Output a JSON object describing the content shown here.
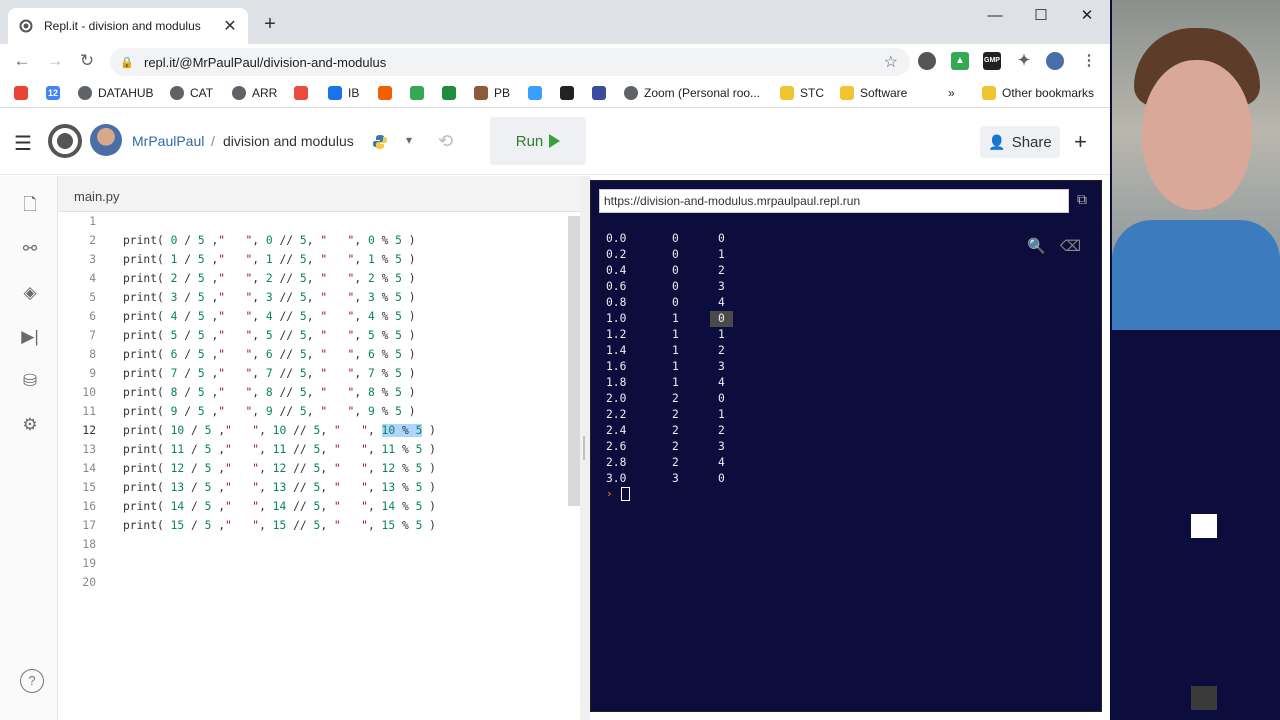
{
  "browser": {
    "tab_title": "Repl.it - division and modulus",
    "url": "repl.it/@MrPaulPaul/division-and-modulus",
    "bookmarks": [
      {
        "label": "",
        "icon": "gmail-icon",
        "color": "#ea4335"
      },
      {
        "label": "",
        "icon": "calendar-icon",
        "color": "#4285f4",
        "text": "12"
      },
      {
        "label": "DATAHUB",
        "icon": "globe-icon",
        "color": "#5f6368"
      },
      {
        "label": "CAT",
        "icon": "globe-icon",
        "color": "#5f6368"
      },
      {
        "label": "ARR",
        "icon": "globe-icon",
        "color": "#5f6368"
      },
      {
        "label": "",
        "icon": "extension-icon",
        "color": "#e94e3c"
      },
      {
        "label": "IB",
        "icon": "ib-icon",
        "color": "#1a73e8"
      },
      {
        "label": "",
        "icon": "red-square-icon",
        "color": "#f06000"
      },
      {
        "label": "",
        "icon": "drive-icon",
        "color": "#34a853"
      },
      {
        "label": "",
        "icon": "classroom-icon",
        "color": "#1e8e3e"
      },
      {
        "label": "PB",
        "icon": "profile-icon",
        "color": "#8d5a3c"
      },
      {
        "label": "",
        "icon": "bolt-icon",
        "color": "#3aa0ff"
      },
      {
        "label": "",
        "icon": "github-icon",
        "color": "#222222"
      },
      {
        "label": "",
        "icon": "calendar-square-icon",
        "color": "#3c4b9e"
      },
      {
        "label": "Zoom (Personal roo...",
        "icon": "globe-icon",
        "color": "#5f6368"
      },
      {
        "label": "STC",
        "icon": "folder-icon",
        "color": "#f4c430"
      },
      {
        "label": "Software",
        "icon": "folder-icon",
        "color": "#f4c430"
      }
    ],
    "more_bookmarks": "»",
    "other_bookmarks": "Other bookmarks"
  },
  "replit": {
    "username": "MrPaulPaul",
    "separator": "/",
    "project_name": "division and modulus",
    "run_label": "Run",
    "share_label": "Share",
    "file_tab": "main.py"
  },
  "editor": {
    "lines": [
      {
        "n": "1",
        "text": ""
      },
      {
        "n": "2",
        "text": "print( 0 / 5 ,\"   \", 0 // 5, \"   \", 0 % 5 )"
      },
      {
        "n": "3",
        "text": "print( 1 / 5 ,\"   \", 1 // 5, \"   \", 1 % 5 )"
      },
      {
        "n": "4",
        "text": "print( 2 / 5 ,\"   \", 2 // 5, \"   \", 2 % 5 )"
      },
      {
        "n": "5",
        "text": "print( 3 / 5 ,\"   \", 3 // 5, \"   \", 3 % 5 )"
      },
      {
        "n": "6",
        "text": "print( 4 / 5 ,\"   \", 4 // 5, \"   \", 4 % 5 )"
      },
      {
        "n": "7",
        "text": "print( 5 / 5 ,\"   \", 5 // 5, \"   \", 5 % 5 )"
      },
      {
        "n": "8",
        "text": "print( 6 / 5 ,\"   \", 6 // 5, \"   \", 6 % 5 )"
      },
      {
        "n": "9",
        "text": "print( 7 / 5 ,\"   \", 7 // 5, \"   \", 7 % 5 )"
      },
      {
        "n": "10",
        "text": "print( 8 / 5 ,\"   \", 8 // 5, \"   \", 8 % 5 )"
      },
      {
        "n": "11",
        "text": "print( 9 / 5 ,\"   \", 9 // 5, \"   \", 9 % 5 )"
      },
      {
        "n": "12",
        "text": "print( 10 / 5 ,\"   \", 10 // 5, \"   \", 10 % 5 )",
        "active": true
      },
      {
        "n": "13",
        "text": "print( 11 / 5 ,\"   \", 11 // 5, \"   \", 11 % 5 )"
      },
      {
        "n": "14",
        "text": "print( 12 / 5 ,\"   \", 12 // 5, \"   \", 12 % 5 )"
      },
      {
        "n": "15",
        "text": "print( 13 / 5 ,\"   \", 13 // 5, \"   \", 13 % 5 )"
      },
      {
        "n": "16",
        "text": "print( 14 / 5 ,\"   \", 14 // 5, \"   \", 14 % 5 )"
      },
      {
        "n": "17",
        "text": "print( 15 / 5 ,\"   \", 15 // 5, \"   \", 15 % 5 )"
      },
      {
        "n": "18",
        "text": ""
      },
      {
        "n": "19",
        "text": ""
      },
      {
        "n": "20",
        "text": ""
      }
    ],
    "selected_text": "10 % 5"
  },
  "console": {
    "url": "https://division-and-modulus.mrpaulpaul.repl.run",
    "rows": [
      [
        "0.0",
        "0",
        "0"
      ],
      [
        "0.2",
        "0",
        "1"
      ],
      [
        "0.4",
        "0",
        "2"
      ],
      [
        "0.6",
        "0",
        "3"
      ],
      [
        "0.8",
        "0",
        "4"
      ],
      [
        "1.0",
        "1",
        "0"
      ],
      [
        "1.2",
        "1",
        "1"
      ],
      [
        "1.4",
        "1",
        "2"
      ],
      [
        "1.6",
        "1",
        "3"
      ],
      [
        "1.8",
        "1",
        "4"
      ],
      [
        "2.0",
        "2",
        "0"
      ],
      [
        "2.2",
        "2",
        "1"
      ],
      [
        "2.4",
        "2",
        "2"
      ],
      [
        "2.6",
        "2",
        "3"
      ],
      [
        "2.8",
        "2",
        "4"
      ],
      [
        "3.0",
        "3",
        "0"
      ]
    ],
    "highlighted_row": 5,
    "prompt": "›"
  },
  "colors": {
    "console_bg": "#0d0d3d",
    "run_green": "#3ba03b",
    "number_green": "#098658",
    "string_red": "#a31515",
    "selection": "#add6ff"
  }
}
